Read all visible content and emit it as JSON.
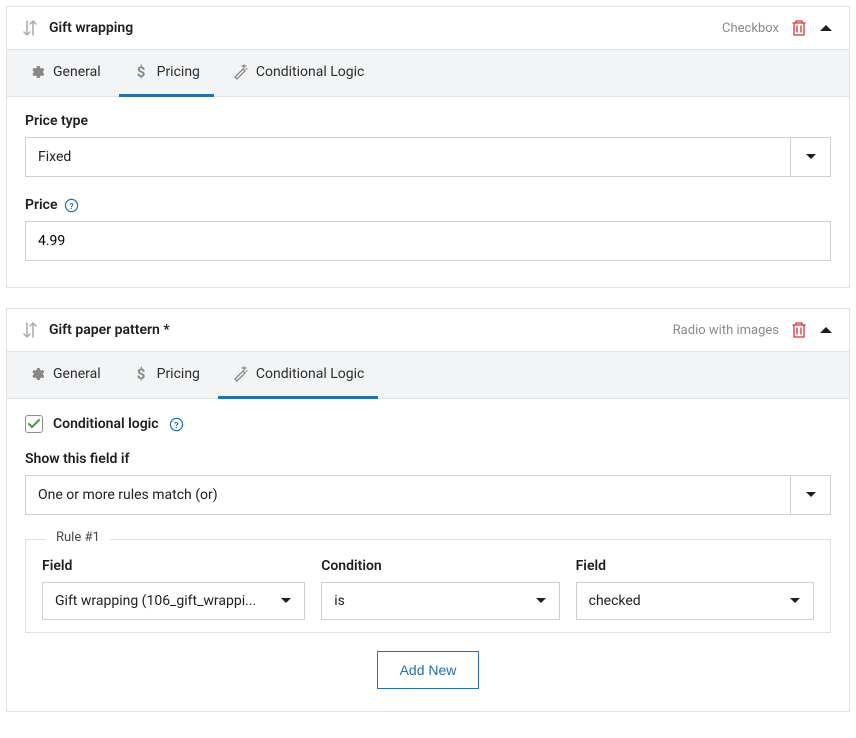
{
  "panel1": {
    "title": "Gift wrapping",
    "type": "Checkbox",
    "tabs": {
      "general": "General",
      "pricing": "Pricing",
      "conditional": "Conditional Logic"
    },
    "priceTypeLabel": "Price type",
    "priceTypeValue": "Fixed",
    "priceLabel": "Price",
    "priceValue": "4.99"
  },
  "panel2": {
    "title": "Gift paper pattern *",
    "type": "Radio with images",
    "tabs": {
      "general": "General",
      "pricing": "Pricing",
      "conditional": "Conditional Logic"
    },
    "conditionalLogicLabel": "Conditional logic",
    "showIfLabel": "Show this field if",
    "showIfValue": "One or more rules match (or)",
    "ruleTitle": "Rule #1",
    "ruleFieldLabel": "Field",
    "ruleFieldValue": "Gift wrapping (106_gift_wrappi...",
    "ruleConditionLabel": "Condition",
    "ruleConditionValue": "is",
    "ruleValueLabel": "Field",
    "ruleValueValue": "checked",
    "addNewLabel": "Add New"
  }
}
